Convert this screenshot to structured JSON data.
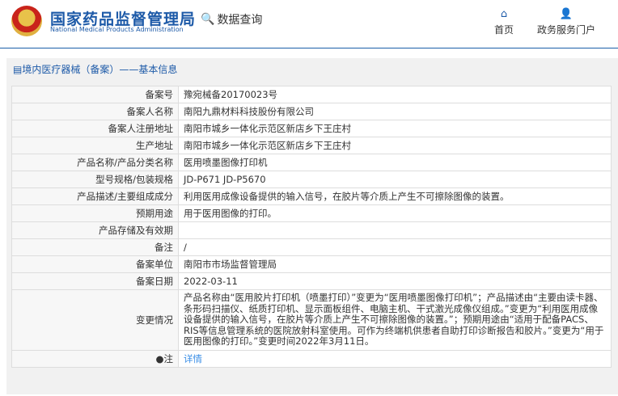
{
  "header": {
    "logo_cn": "国家药品监督管理局",
    "logo_en": "National Medical Products Administration",
    "data_query": "数据查询",
    "nav": [
      {
        "label": "首页",
        "icon": "home-icon"
      },
      {
        "label": "政务服务门户",
        "icon": "user-icon"
      }
    ]
  },
  "panel": {
    "title": "境内医疗器械（备案）——基本信息"
  },
  "rows": [
    {
      "label": "备案号",
      "value": "豫宛械备20170023号"
    },
    {
      "label": "备案人名称",
      "value": "南阳九鼎材料科技股份有限公司"
    },
    {
      "label": "备案人注册地址",
      "value": "南阳市城乡一体化示范区新店乡下王庄村"
    },
    {
      "label": "生产地址",
      "value": "南阳市城乡一体化示范区新店乡下王庄村"
    },
    {
      "label": "产品名称/产品分类名称",
      "value": "医用喷墨图像打印机"
    },
    {
      "label": "型号规格/包装规格",
      "value": "JD-P671 JD-P5670"
    },
    {
      "label": "产品描述/主要组成成分",
      "value": "利用医用成像设备提供的输入信号，在胶片等介质上产生不可擦除图像的装置。"
    },
    {
      "label": "预期用途",
      "value": "用于医用图像的打印。"
    },
    {
      "label": "产品存储及有效期",
      "value": ""
    },
    {
      "label": "备注",
      "value": "/"
    },
    {
      "label": "备案单位",
      "value": "南阳市市场监督管理局"
    },
    {
      "label": "备案日期",
      "value": "2022-03-11"
    },
    {
      "label": "变更情况",
      "value": "产品名称由“医用胶片打印机（喷墨打印）”变更为“医用喷墨图像打印机”；产品描述由“主要由读卡器、条形码扫描仪、纸质打印机、显示面板组件、电脑主机、干式激光成像仪组成。”变更为“利用医用成像设备提供的输入信号，在胶片等介质上产生不可擦除图像的装置。”；预期用途由“适用于配备PACS、RIS等信息管理系统的医院放射科室使用。可作为终端机供患者自助打印诊断报告和胶片。”变更为“用于医用图像的打印。”变更时间2022年3月11日。"
    }
  ],
  "note": {
    "label": "注",
    "link": "详情"
  }
}
